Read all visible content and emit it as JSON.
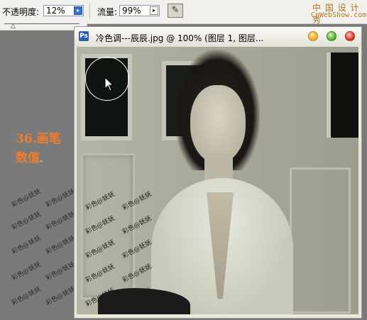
{
  "options_bar": {
    "opacity_label": "不透明度:",
    "opacity_value": "12%",
    "flow_label": "流量:",
    "flow_value": "99%",
    "airbrush_icon": "airbrush-icon"
  },
  "watermark": {
    "site_cn": "中 国 设 计 秀",
    "site_en": "CnWebShow.com"
  },
  "left_panel": {
    "tip_line1": "36.画笔",
    "tip_line2": "数值",
    "tip_dot": "。",
    "watermark_text": "彩色@妩妩"
  },
  "document": {
    "title": "冷色调---辰辰.jpg @ 100% (图层 1, 图层...",
    "icon": "document-icon",
    "buttons": [
      "minimize",
      "maximize",
      "close"
    ]
  },
  "colors": {
    "tip": "#f07c2a",
    "workspace": "#7a7a7a",
    "photo_tone": "#a8a99a"
  }
}
